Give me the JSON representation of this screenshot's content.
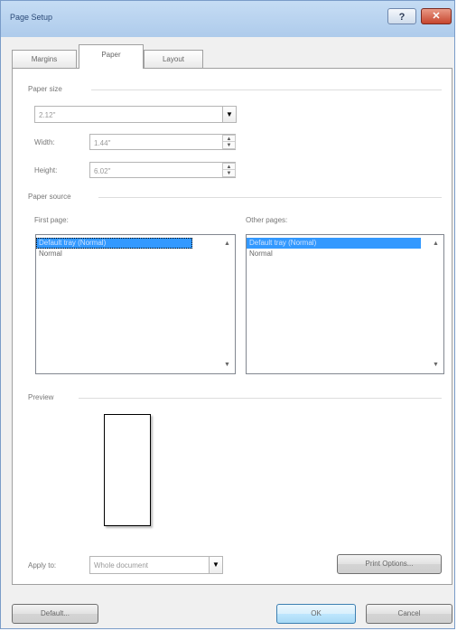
{
  "window": {
    "title": "Page Setup",
    "help_glyph": "?",
    "close_glyph": "✕"
  },
  "tabs": [
    {
      "label": "Margins"
    },
    {
      "label": "Paper"
    },
    {
      "label": "Layout"
    }
  ],
  "paper_size": {
    "section_label": "Paper size",
    "selected": "2.12\"",
    "width_label": "Width:",
    "width_value": "1.44\"",
    "height_label": "Height:",
    "height_value": "6.02\""
  },
  "paper_source": {
    "section_label": "Paper source",
    "first_page_label": "First page:",
    "other_pages_label": "Other pages:",
    "first_page_items": [
      "Default tray (Normal)",
      "Normal"
    ],
    "other_pages_items": [
      "Default tray (Normal)",
      "Normal"
    ]
  },
  "preview": {
    "section_label": "Preview"
  },
  "apply_to": {
    "label": "Apply to:",
    "value": "Whole document"
  },
  "buttons": {
    "print_options": "Print Options...",
    "default": "Default...",
    "ok": "OK",
    "cancel": "Cancel"
  },
  "icons": {
    "dropdown": "chevron-down-icon",
    "spin_up": "triangle-up-icon",
    "spin_down": "triangle-down-icon"
  }
}
